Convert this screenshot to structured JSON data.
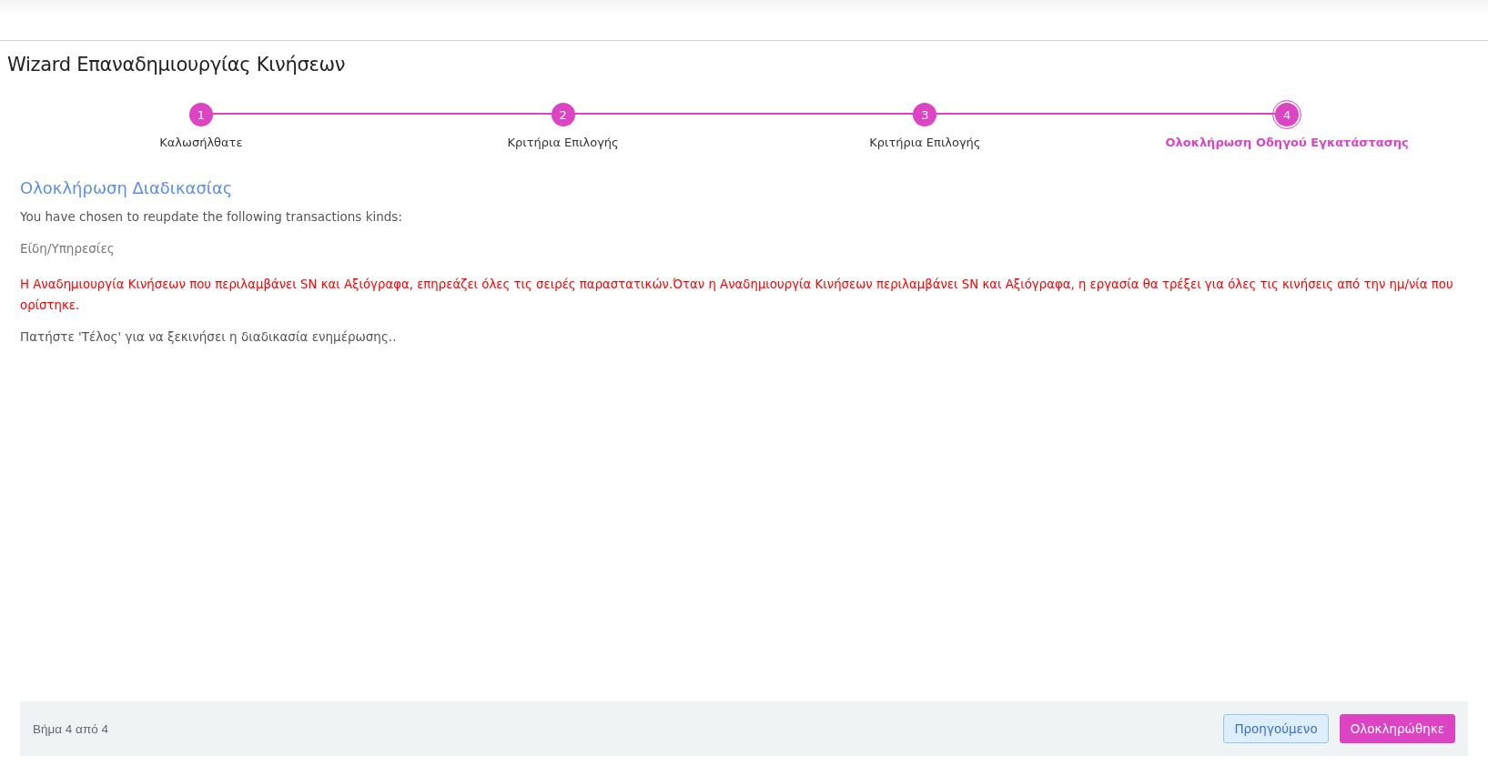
{
  "title": "Wizard Επαναδημιουργίας Κινήσεων",
  "steps": [
    {
      "number": "1",
      "label": "Καλωσήλθατε",
      "selected": false
    },
    {
      "number": "2",
      "label": "Κριτήρια Επιλογής",
      "selected": false
    },
    {
      "number": "3",
      "label": "Κριτήρια Επιλογής",
      "selected": false
    },
    {
      "number": "4",
      "label": "Ολοκλήρωση Οδηγού Εγκατάστασης",
      "selected": true
    }
  ],
  "section": {
    "heading": "Ολοκλήρωση Διαδικασίας",
    "intro": "You have chosen to reupdate the following transactions kinds:",
    "kinds": "Είδη/Υπηρεσίες",
    "warning": "Η Αναδημιουργία Κινήσεων που περιλαμβάνει SN και Αξιόγραφα, επηρεάζει όλες τις σειρές παραστατικών.Όταν η Αναδημιουργία Κινήσεων περιλαμβάνει SN και Αξιόγραφα, η εργασία θα τρέξει για όλες τις κινήσεις από την ημ/νία που ορίστηκε.",
    "instruction": "Πατήστε 'Τέλος' για να ξεκινήσει η διαδικασία ενημέρωσης.."
  },
  "footer": {
    "step_text": "Βήμα 4 από 4",
    "previous_button": "Προηγούμενο",
    "finish_button": "Ολοκληρώθηκε"
  }
}
